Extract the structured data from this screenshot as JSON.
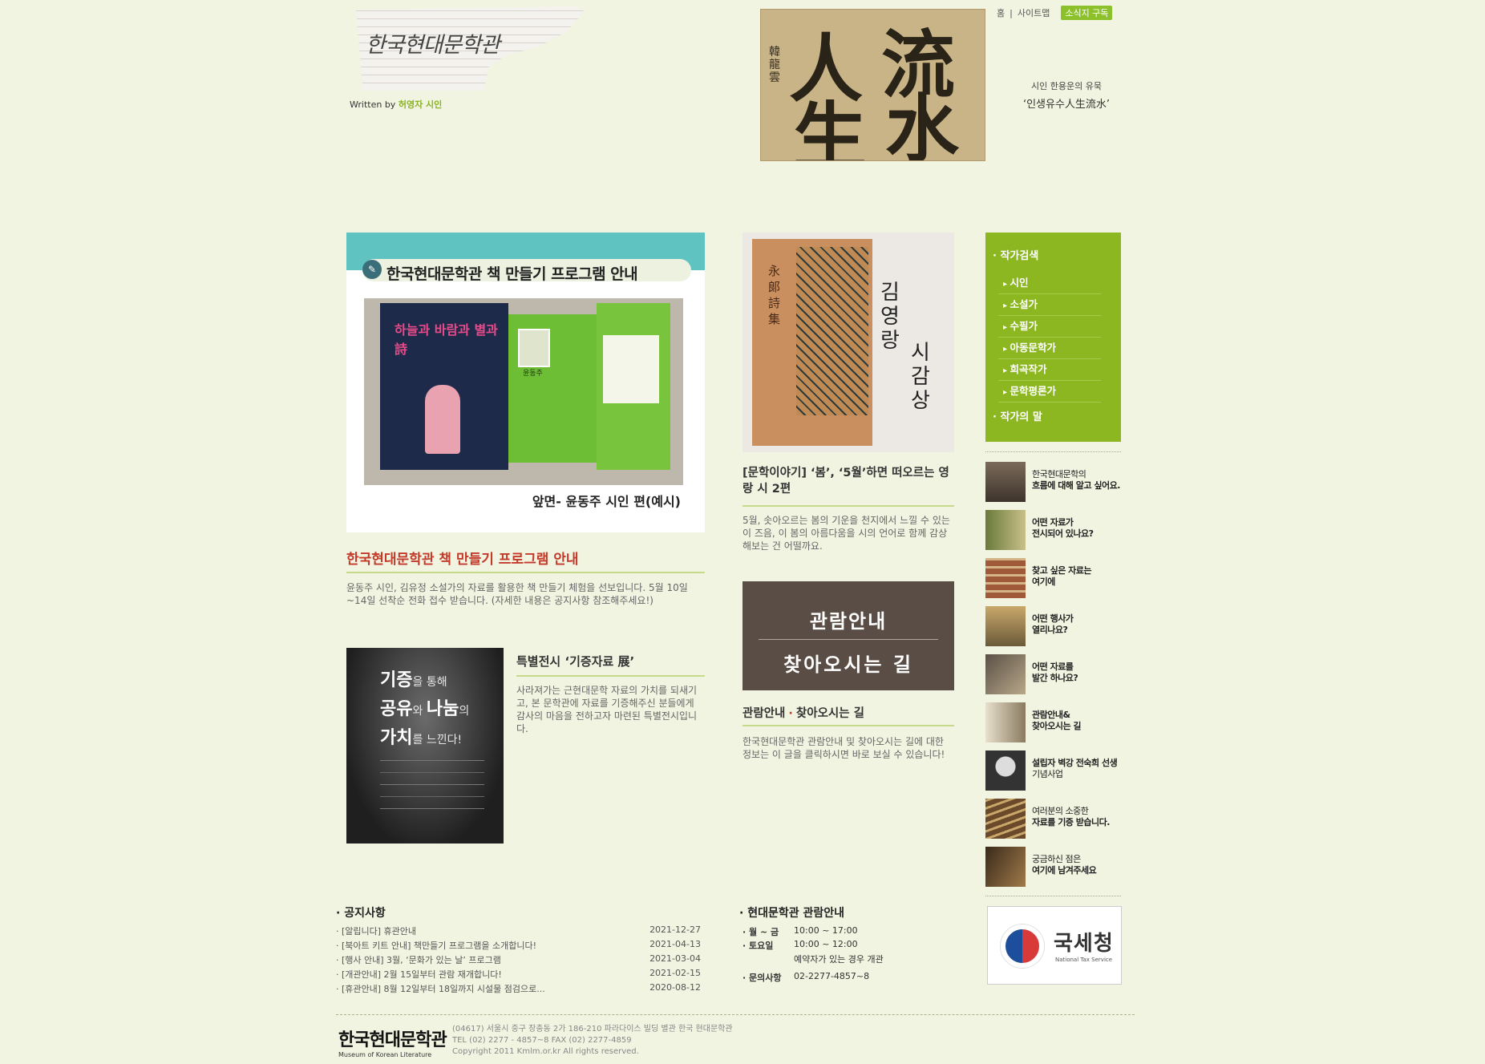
{
  "header": {
    "logo_text": "한국현대문학관",
    "written_by_prefix": "Written by",
    "written_by_name": "허영자 시인",
    "calligraphy_chars": [
      "人",
      "流",
      "生",
      "水"
    ],
    "calligraphy_signature": "韓龍雲",
    "calligraphy_caption_line1": "시인 한용운의 유묵",
    "calligraphy_caption_line2": "‘인생유수人生流水’",
    "top_links": [
      "홈",
      "사이트맵"
    ],
    "subscribe_label": "소식지 구독"
  },
  "feature_book_program": {
    "banner_text": "한국현대문학관 책 만들기 프로그램 안내",
    "book_title": "하늘과 바람과 별과 詩",
    "book_portrait_label": "윤동주",
    "image_caption": "앞면- 윤동주 시인 편(예시)",
    "title": "한국현대문학관 책 만들기 프로그램 안내",
    "description": "윤동주 시인, 김유정 소설가의 자료를 활용한 책 만들기 체험을 선보입니다. 5월 10일~14일 선착순 전화 접수 받습니다. (자세한 내용은 공지사항 참조해주세요!)"
  },
  "feature_kimyoungrang": {
    "book_cover_text": "永郞詩集",
    "overlay_line1": "김영랑",
    "overlay_line2": "시감상",
    "title": "[문학이야기] ‘봄’, ‘5월’하면 떠오르는 영랑 시 2편",
    "description": "5월, 솟아오르는 봄의 기운을 천지에서 느낄 수 있는 이 즈음, 이 봄의 아름다움을 시의 언어로 함께 감상해보는 건 어떨까요."
  },
  "feature_visit": {
    "image_line1": "관람안내",
    "image_line2": "찾아오시는 길",
    "title_part1": "관람안내",
    "title_sep": "·",
    "title_part2": "찾아오시는 길",
    "description": "한국현대문학관 관람안내 및 찾아오시는 길에 대한 정보는 이 글을 클릭하시면 바로 보실 수 있습니다!"
  },
  "feature_donation": {
    "image_l1a": "기증",
    "image_l1b": "을 통해",
    "image_l2a": "공유",
    "image_l2b": "와 ",
    "image_l2c": "나눔",
    "image_l2d": "의",
    "image_l3a": "가치",
    "image_l3b": "를 느낀다!",
    "title": "특별전시 ‘기증자료 展’",
    "description": "사라져가는 근현대문학 자료의 가치를 되새기고, 본 문학관에 자료를 기증해주신 분들에게 감사의 마음을 전하고자 마련된 특별전시입니다."
  },
  "sidebar": {
    "section1": "· 작가검색",
    "items": [
      "시인",
      "소설가",
      "수필가",
      "아동문학가",
      "희곡작가",
      "문학평론가"
    ],
    "section2": "· 작가의 말"
  },
  "quick_links": [
    {
      "line1": "한국현대문학의",
      "line2": "흐름에 대해 알고 싶어요."
    },
    {
      "line1": "어떤 자료가",
      "line2": "전시되어 있나요?"
    },
    {
      "line1": "찾고 싶은 자료는",
      "line2": "여기에"
    },
    {
      "line1": "어떤 행사가",
      "line2": "열리나요?"
    },
    {
      "line1": "어떤 자료를",
      "line2": "발간 하나요?"
    },
    {
      "line1": "관람안내&",
      "line2": "찾아오시는 길"
    },
    {
      "line1": "설립자 벽강 전숙희 선생",
      "line2": "기념사업"
    },
    {
      "line1": "여러분의 소중한",
      "line2": "자료를 기증 받습니다."
    },
    {
      "line1": "궁금하신 점은",
      "line2": "여기에 남겨주세요"
    }
  ],
  "banner_nts": {
    "name": "국세청",
    "sub": "National Tax Service"
  },
  "notices": {
    "heading": "· 공지사항",
    "items": [
      {
        "title": "· [알립니다] 휴관안내",
        "date": "2021-12-27"
      },
      {
        "title": "· [북아트 키트 안내] 책만들기 프로그램을 소개합니다!",
        "date": "2021-04-13"
      },
      {
        "title": "· [행사 안내] 3월, ‘문화가 있는 날’ 프로그램",
        "date": "2021-03-04"
      },
      {
        "title": "· [개관안내] 2월 15일부터 관람 재개합니다!",
        "date": "2021-02-15"
      },
      {
        "title": "· [휴관안내] 8월 12일부터 18일까지 시설물 점검으로...",
        "date": "2020-08-12"
      }
    ]
  },
  "visit_info": {
    "heading": "· 현대문학관 관람안내",
    "rows": [
      {
        "label": "· 월 ~ 금",
        "value": "10:00 ~ 17:00"
      },
      {
        "label": "· 토요일",
        "value": "10:00 ~ 12:00"
      },
      {
        "label": "",
        "value": "예약자가 있는 경우  개관"
      },
      {
        "label": "· 문의사항",
        "value": "02-2277-4857~8"
      }
    ]
  },
  "footer": {
    "logo_kr": "한국현대문학관",
    "logo_en": "Museum of Korean Literature",
    "address": "(04617) 서울시 중구 장충동 2가 186-210 파라다이스 빌딩 별관 한국 현대문학관",
    "tel": "TEL (02) 2277 - 4857~8 FAX (02) 2277-4859",
    "copyright": "Copyright 2011 Kmlm.or.kr All rights reserved."
  },
  "colors": {
    "background": "#f0f4e0",
    "accent_green": "#8cb720",
    "title_red": "#c43a2a"
  }
}
